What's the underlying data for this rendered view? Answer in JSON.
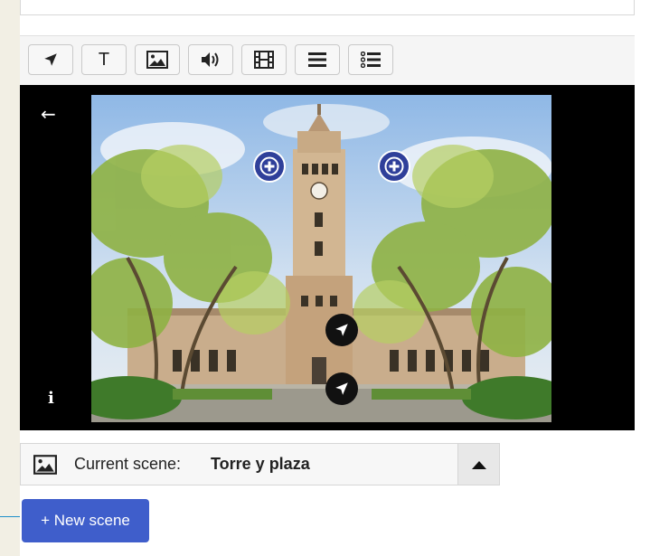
{
  "toolbar": {
    "text_tool_label": "T",
    "buttons": [
      "navigation-icon",
      "text-icon",
      "image-icon",
      "audio-icon",
      "video-icon",
      "summary-icon",
      "list-icon"
    ]
  },
  "viewer": {
    "back_symbol": "←",
    "info_symbol": "i",
    "hotspots": [
      "plus",
      "plus",
      "navigate",
      "navigate"
    ]
  },
  "scene_selector": {
    "label": "Current scene:",
    "current_scene": "Torre y plaza"
  },
  "actions": {
    "new_scene_label": "+ New scene"
  },
  "colors": {
    "accent": "#3f5ecb",
    "hotspot_plus": "#2f3f9a",
    "hotspot_nav": "#111111"
  }
}
